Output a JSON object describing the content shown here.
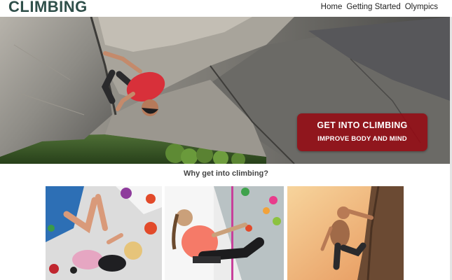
{
  "header": {
    "logo": "CLIMBING",
    "nav": [
      {
        "label": "Home"
      },
      {
        "label": "Getting Started"
      },
      {
        "label": "Olympics"
      }
    ]
  },
  "hero": {
    "button_title": "GET INTO CLIMBING",
    "button_subtitle": "IMPROVE BODY AND MIND",
    "button_color": "#960812"
  },
  "section": {
    "heading": "Why get into climbing?"
  },
  "colors": {
    "logo": "#2f4f4a",
    "rock": "#8c8a84",
    "shirt": "#d8303a"
  }
}
